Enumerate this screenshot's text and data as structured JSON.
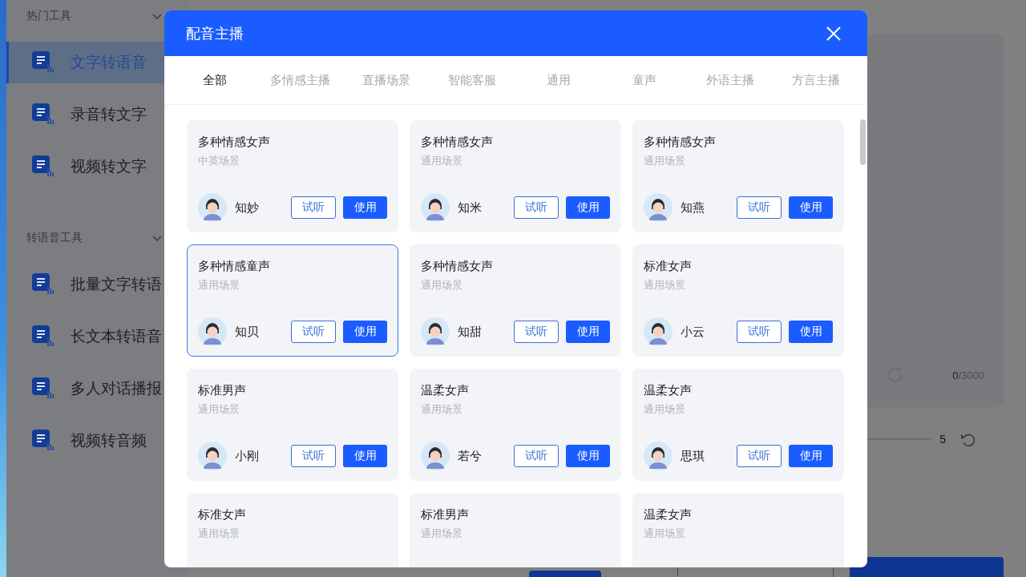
{
  "sidebar": {
    "sections": [
      {
        "title": "热门工具",
        "expanded": true,
        "items": [
          {
            "label": "文字转语音",
            "selected": true
          },
          {
            "label": "录音转文字",
            "selected": false
          },
          {
            "label": "视频转文字",
            "selected": false
          }
        ]
      },
      {
        "title": "转语音工具",
        "expanded": true,
        "items": [
          {
            "label": "批量文字转语",
            "selected": false
          },
          {
            "label": "长文本转语音",
            "selected": false
          },
          {
            "label": "多人对话播报",
            "selected": false
          },
          {
            "label": "视频转音频",
            "selected": false
          }
        ]
      }
    ]
  },
  "editor": {
    "count": "0",
    "limit": "/3000"
  },
  "speed": {
    "value": "5"
  },
  "actions": [
    {
      "kind": "small"
    },
    {
      "kind": "outline"
    },
    {
      "kind": "primary"
    }
  ],
  "dialog": {
    "title": "配音主播",
    "tabs": [
      {
        "label": "全部",
        "selected": true
      },
      {
        "label": "多情感主播",
        "selected": false
      },
      {
        "label": "直播场景",
        "selected": false
      },
      {
        "label": "智能客服",
        "selected": false
      },
      {
        "label": "通用",
        "selected": false
      },
      {
        "label": "童声",
        "selected": false
      },
      {
        "label": "外语主播",
        "selected": false
      },
      {
        "label": "方言主播",
        "selected": false
      }
    ],
    "voices": [
      {
        "title": "多种情感女声",
        "scene": "中英场景",
        "name": "知妙",
        "try_label": "试听",
        "use_label": "使用",
        "selected": false
      },
      {
        "title": "多种情感女声",
        "scene": "通用场景",
        "name": "知米",
        "try_label": "试听",
        "use_label": "使用",
        "selected": false
      },
      {
        "title": "多种情感女声",
        "scene": "通用场景",
        "name": "知燕",
        "try_label": "试听",
        "use_label": "使用",
        "selected": false
      },
      {
        "title": "多种情感童声",
        "scene": "通用场景",
        "name": "知贝",
        "try_label": "试听",
        "use_label": "使用",
        "selected": true
      },
      {
        "title": "多种情感女声",
        "scene": "通用场景",
        "name": "知甜",
        "try_label": "试听",
        "use_label": "使用",
        "selected": false
      },
      {
        "title": "标准女声",
        "scene": "通用场景",
        "name": "小云",
        "try_label": "试听",
        "use_label": "使用",
        "selected": false
      },
      {
        "title": "标准男声",
        "scene": "通用场景",
        "name": "小刚",
        "try_label": "试听",
        "use_label": "使用",
        "selected": false
      },
      {
        "title": "温柔女声",
        "scene": "通用场景",
        "name": "若兮",
        "try_label": "试听",
        "use_label": "使用",
        "selected": false
      },
      {
        "title": "温柔女声",
        "scene": "通用场景",
        "name": "思琪",
        "try_label": "试听",
        "use_label": "使用",
        "selected": false
      },
      {
        "title": "标准女声",
        "scene": "通用场景",
        "selected": false
      },
      {
        "title": "标准男声",
        "scene": "通用场景",
        "selected": false
      },
      {
        "title": "温柔女声",
        "scene": "通用场景",
        "selected": false
      }
    ]
  }
}
